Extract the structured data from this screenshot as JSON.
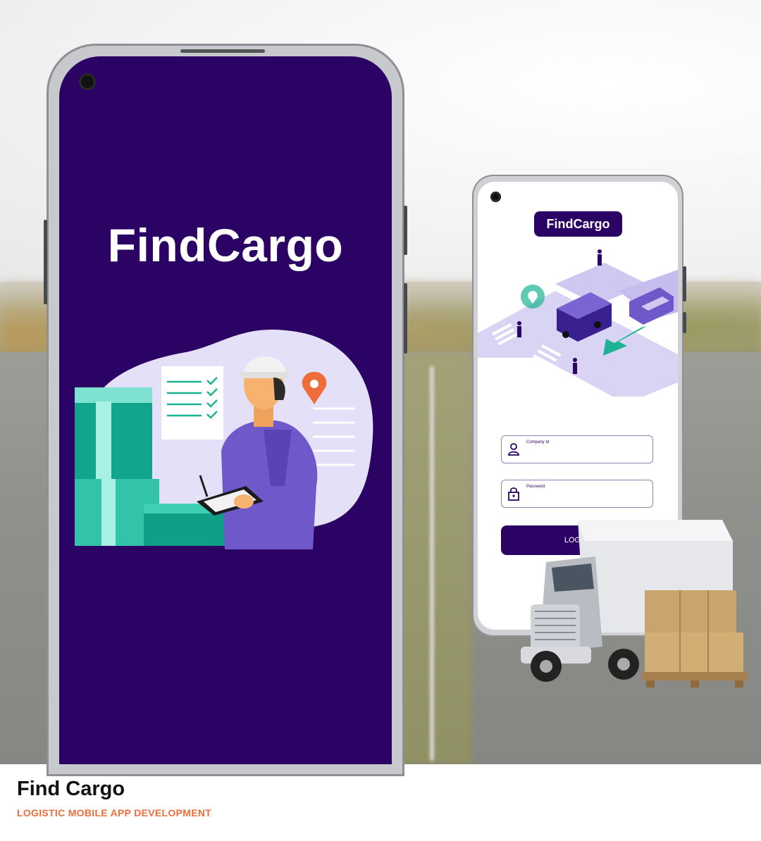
{
  "splash": {
    "brand": "FindCargo"
  },
  "login": {
    "brand": "FindCargo",
    "company_id_label": "Company Id",
    "password_label": "Password",
    "login_button": "LOGIN"
  },
  "caption": {
    "title": "Find Cargo",
    "subtitle": "LOGISTIC MOBILE APP DEVELOPMENT"
  },
  "colors": {
    "brand_purple": "#2b0364",
    "accent_teal": "#1bb394",
    "accent_orange": "#ee6d3a",
    "lavender": "#d9d4f3"
  },
  "icons": [
    "location-pin-icon",
    "user-icon",
    "lock-icon",
    "checkmark-icon"
  ]
}
